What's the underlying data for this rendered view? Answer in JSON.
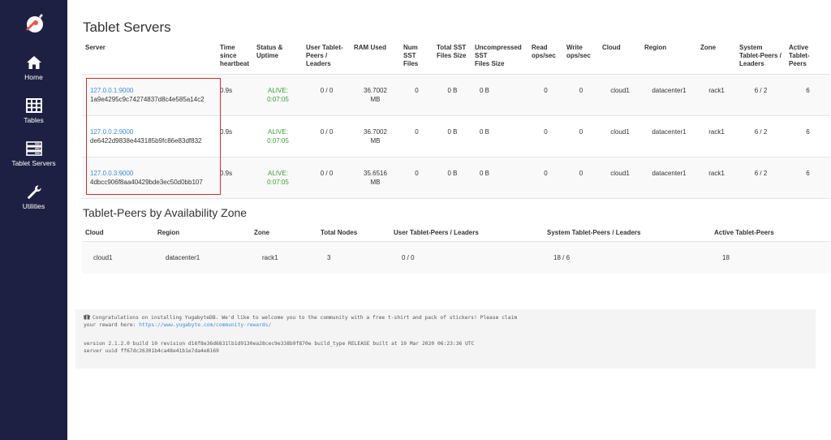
{
  "sidebar": {
    "items": [
      {
        "label": "Home",
        "icon": "home-icon"
      },
      {
        "label": "Tables",
        "icon": "table-icon"
      },
      {
        "label": "Tablet Servers",
        "icon": "server-icon"
      },
      {
        "label": "Utilities",
        "icon": "wrench-icon"
      }
    ],
    "colors": {
      "background": "#1e2043",
      "text": "#ffffff"
    }
  },
  "tablet_servers": {
    "title": "Tablet Servers",
    "headers": {
      "server": "Server",
      "time_l1": "Time",
      "time_l2": "since",
      "time_l3": "heartbeat",
      "status_l1": "Status &",
      "status_l2": "Uptime",
      "peers_l1": "User Tablet-",
      "peers_l2": "Peers /",
      "peers_l3": "Leaders",
      "ram": "RAM Used",
      "sst_l1": "Num",
      "sst_l2": "SST",
      "sst_l3": "Files",
      "total_sst_l1": "Total SST",
      "total_sst_l2": "Files Size",
      "uncomp_l1": "Uncompressed",
      "uncomp_l2": "SST",
      "uncomp_l3": "Files Size",
      "read_l1": "Read",
      "read_l2": "ops/sec",
      "write_l1": "Write",
      "write_l2": "ops/sec",
      "cloud": "Cloud",
      "region": "Region",
      "zone": "Zone",
      "sys_l1": "System",
      "sys_l2": "Tablet-Peers /",
      "sys_l3": "Leaders",
      "active_l1": "Active",
      "active_l2": "Tablet-",
      "active_l3": "Peers"
    },
    "rows": [
      {
        "address": "127.0.0.1:9000",
        "uuid": "1a9e4295c9c74274837d8c4e585a14c2",
        "heartbeat": "0.9s",
        "status": "ALIVE:",
        "uptime": "0:07:05",
        "user_peers": "0 / 0",
        "ram_1": "36.7002",
        "ram_2": "MB",
        "sst_files": "0",
        "total_sst": "0 B",
        "uncompressed": "0 B",
        "read_ops": "0",
        "write_ops": "0",
        "cloud": "cloud1",
        "region": "datacenter1",
        "zone": "rack1",
        "system_peers": "6 / 2",
        "active_peers": "6"
      },
      {
        "address": "127.0.0.2:9000",
        "uuid": "de6422d9838e443185b9fc86e83df832",
        "heartbeat": "0.9s",
        "status": "ALIVE:",
        "uptime": "0:07:05",
        "user_peers": "0 / 0",
        "ram_1": "36.7002",
        "ram_2": "MB",
        "sst_files": "0",
        "total_sst": "0 B",
        "uncompressed": "0 B",
        "read_ops": "0",
        "write_ops": "0",
        "cloud": "cloud1",
        "region": "datacenter1",
        "zone": "rack1",
        "system_peers": "6 / 2",
        "active_peers": "6"
      },
      {
        "address": "127.0.0.3:9000",
        "uuid": "4dbcc906f8aa40429bde3ec50d0bb107",
        "heartbeat": "0.9s",
        "status": "ALIVE:",
        "uptime": "0:07:05",
        "user_peers": "0 / 0",
        "ram_1": "35.6516",
        "ram_2": "MB",
        "sst_files": "0",
        "total_sst": "0 B",
        "uncompressed": "0 B",
        "read_ops": "0",
        "write_ops": "0",
        "cloud": "cloud1",
        "region": "datacenter1",
        "zone": "rack1",
        "system_peers": "6 / 2",
        "active_peers": "6"
      }
    ]
  },
  "zones": {
    "title": "Tablet-Peers by Availability Zone",
    "headers": {
      "cloud": "Cloud",
      "region": "Region",
      "zone": "Zone",
      "total_nodes": "Total Nodes",
      "user_peers": "User Tablet-Peers / Leaders",
      "system_peers": "System Tablet-Peers / Leaders",
      "active_peers": "Active Tablet-Peers"
    },
    "rows": [
      {
        "cloud": "cloud1",
        "region": "datacenter1",
        "zone": "rack1",
        "total_nodes": "3",
        "user_peers": "0 / 0",
        "system_peers": "18 / 6",
        "active_peers": "18"
      }
    ]
  },
  "footer": {
    "congrats_line1": "Congratulations on installing YugabyteDB. We'd like to welcome you to the community with a free t-shirt and pack of stickers! Please claim",
    "congrats_line2": "your reward here: ",
    "reward_link": "https://www.yugabyte.com/community-rewards/",
    "version": "version 2.1.2.0 build 10 revision d16f8e36d6831lb1d9130ea28cec9e338b9f870e build_type RELEASE built at 10 Mar 2020 06:23:36 UTC",
    "server_uuid": "server uuid ff67dc26301b4ca48e41b1e7da4e8169"
  },
  "colors": {
    "link": "#3c8ed4",
    "alive": "#3aa03a",
    "highlight": "#d22f2f"
  }
}
